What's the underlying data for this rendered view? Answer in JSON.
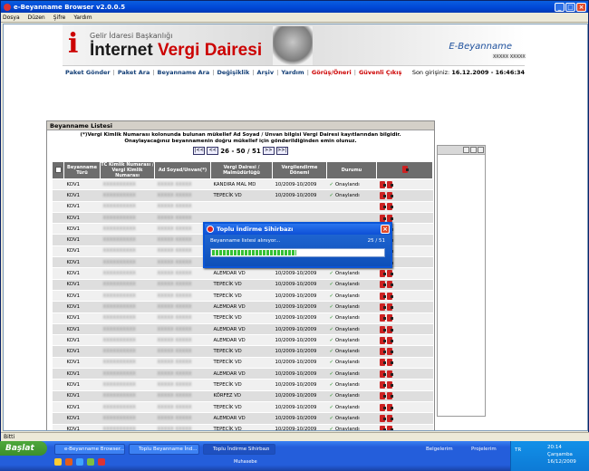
{
  "window": {
    "title": "e-Beyanname Browser v2.0.0.5"
  },
  "menu": [
    "Dosya",
    "Düzen",
    "Şifre",
    "Yardım"
  ],
  "header": {
    "org": "Gelir İdaresi Başkanlığı",
    "brand_main": "İnternet",
    "brand_sub": "Vergi Dairesi",
    "product": "E-Beyanname"
  },
  "nav": {
    "items": [
      "Paket Gönder",
      "Paket Ara",
      "Beyanname Ara",
      "Değişiklik",
      "Arşiv",
      "Yardım"
    ],
    "feedback": "Görüş/Öneri",
    "logout": "Güvenli Çıkış",
    "last_login_label": "Son girişiniz:",
    "last_login_value": "16.12.2009 - 16:46:34"
  },
  "list": {
    "title": "Beyanname Listesi",
    "notice": "(*)Vergi Kimlik Numarası kolonunda bulunan mükellef Ad Soyad / Unvan bilgisi Vergi Dairesi kayıtlarından bilgidir. Onaylayacağınız beyannamenin doğru mükellef için gönderildiğinden emin olunuz.",
    "pager": {
      "first": "|<<",
      "prev": "<<",
      "range": "26 - 50 / 51",
      "next": ">>",
      "last": ">>|"
    },
    "columns": [
      "Beyanname Türü",
      "TC Kimlik Numarası / Vergi Kimlik Numarası",
      "Ad Soyad/Unvan(*)",
      "Vergi Dairesi / Malmüdürlüğü",
      "Vergilendirme Dönemi",
      "Durumu"
    ],
    "rows": [
      {
        "type": "KDV1",
        "id": "XXXXXXXXXX",
        "name": "XXXXX XXXXX",
        "office": "KANDIRA MAL MD",
        "period": "10/2009-10/2009",
        "status": "Onaylandı"
      },
      {
        "type": "KDV1",
        "id": "XXXXXXXXXX",
        "name": "XXXXX XXXXX",
        "office": "TEPECİK VD",
        "period": "10/2009-10/2009",
        "status": "Onaylandı"
      },
      {
        "type": "KDV1",
        "id": "XXXXXXXXXX",
        "name": "XXXXX XXXXX",
        "office": "",
        "period": "",
        "status": ""
      },
      {
        "type": "KDV1",
        "id": "XXXXXXXXXX",
        "name": "XXXXX XXXXX",
        "office": "",
        "period": "",
        "status": ""
      },
      {
        "type": "KDV1",
        "id": "XXXXXXXXXX",
        "name": "XXXXX XXXXX",
        "office": "",
        "period": "",
        "status": ""
      },
      {
        "type": "KDV1",
        "id": "XXXXXXXXXX",
        "name": "XXXXX XXXXX",
        "office": "",
        "period": "",
        "status": ""
      },
      {
        "type": "KDV1",
        "id": "XXXXXXXXXX",
        "name": "XXXXX XXXXX",
        "office": "",
        "period": "",
        "status": ""
      },
      {
        "type": "KDV1",
        "id": "XXXXXXXXXX",
        "name": "XXXXX XXXXX",
        "office": "",
        "period": "",
        "status": ""
      },
      {
        "type": "KDV1",
        "id": "XXXXXXXXXX",
        "name": "XXXXX XXXXX",
        "office": "ALEMDAR VD",
        "period": "10/2009-10/2009",
        "status": "Onaylandı"
      },
      {
        "type": "KDV1",
        "id": "XXXXXXXXXX",
        "name": "XXXXX XXXXX",
        "office": "TEPECİK VD",
        "period": "10/2009-10/2009",
        "status": "Onaylandı"
      },
      {
        "type": "KDV1",
        "id": "XXXXXXXXXX",
        "name": "XXXXX XXXXX",
        "office": "TEPECİK VD",
        "period": "10/2009-10/2009",
        "status": "Onaylandı"
      },
      {
        "type": "KDV1",
        "id": "XXXXXXXXXX",
        "name": "XXXXX XXXXX",
        "office": "ALEMDAR VD",
        "period": "10/2009-10/2009",
        "status": "Onaylandı"
      },
      {
        "type": "KDV1",
        "id": "XXXXXXXXXX",
        "name": "XXXXX XXXXX",
        "office": "TEPECİK VD",
        "period": "10/2009-10/2009",
        "status": "Onaylandı"
      },
      {
        "type": "KDV1",
        "id": "XXXXXXXXXX",
        "name": "XXXXX XXXXX",
        "office": "ALEMDAR VD",
        "period": "10/2009-10/2009",
        "status": "Onaylandı"
      },
      {
        "type": "KDV1",
        "id": "XXXXXXXXXX",
        "name": "XXXXX XXXXX",
        "office": "ALEMDAR VD",
        "period": "10/2009-10/2009",
        "status": "Onaylandı"
      },
      {
        "type": "KDV1",
        "id": "XXXXXXXXXX",
        "name": "XXXXX XXXXX",
        "office": "TEPECİK VD",
        "period": "10/2009-10/2009",
        "status": "Onaylandı"
      },
      {
        "type": "KDV1",
        "id": "XXXXXXXXXX",
        "name": "XXXXX XXXXX",
        "office": "TEPECİK VD",
        "period": "10/2009-10/2009",
        "status": "Onaylandı"
      },
      {
        "type": "KDV1",
        "id": "XXXXXXXXXX",
        "name": "XXXXX XXXXX",
        "office": "ALEMDAR VD",
        "period": "10/2009-10/2009",
        "status": "Onaylandı"
      },
      {
        "type": "KDV1",
        "id": "XXXXXXXXXX",
        "name": "XXXXX XXXXX",
        "office": "TEPECİK VD",
        "period": "10/2009-10/2009",
        "status": "Onaylandı"
      },
      {
        "type": "KDV1",
        "id": "XXXXXXXXXX",
        "name": "XXXXX XXXXX",
        "office": "KÖRFEZ VD",
        "period": "10/2009-10/2009",
        "status": "Onaylandı"
      },
      {
        "type": "KDV1",
        "id": "XXXXXXXXXX",
        "name": "XXXXX XXXXX",
        "office": "TEPECİK VD",
        "period": "10/2009-10/2009",
        "status": "Onaylandı"
      },
      {
        "type": "KDV1",
        "id": "XXXXXXXXXX",
        "name": "XXXXX XXXXX",
        "office": "ALEMDAR VD",
        "period": "10/2009-10/2009",
        "status": "Onaylandı"
      },
      {
        "type": "KDV1",
        "id": "XXXXXXXXXX",
        "name": "XXXXX XXXXX",
        "office": "TEPECİK VD",
        "period": "10/2009-10/2009",
        "status": "Onaylandı"
      },
      {
        "type": "KDV1",
        "id": "XXXXXXXXXX",
        "name": "XXXXX XXXXX",
        "office": "TEPECİK VD",
        "period": "10/2009-10/2009",
        "status": "Onaylandı"
      },
      {
        "type": "KDV1",
        "id": "XXXXXXXXXX",
        "name": "XXXXX XXXXX",
        "office": "TEPECİK VD",
        "period": "10/2009-10/2009",
        "status": "Onaylandı"
      },
      {
        "type": "KDV1",
        "id": "XXXXXXXXXX",
        "name": "XXXXX XXXXX",
        "office": "ALEMDAR VD",
        "period": "10/2009-10/2009",
        "status": "Onaylandı"
      }
    ]
  },
  "dialog": {
    "title": "Toplu İndirme Sihirbazı",
    "message": "Beyanname listesi alınıyor...",
    "counter": "25 / 51",
    "progress": 0.49
  },
  "statusbar": {
    "text": "Bitti"
  },
  "taskbar": {
    "start": "Başlat",
    "tasks": [
      "e-Beyanname Browser...",
      "Toplu Beyanname İnd...",
      "Toplu İndirme Sihirbazı"
    ],
    "links": [
      "Belgelerim",
      "Projelerim"
    ],
    "quick_label": "Muhasebe",
    "lang": "TR",
    "time": "20:14",
    "day": "Çarşamba",
    "date": "16/12/2009"
  }
}
